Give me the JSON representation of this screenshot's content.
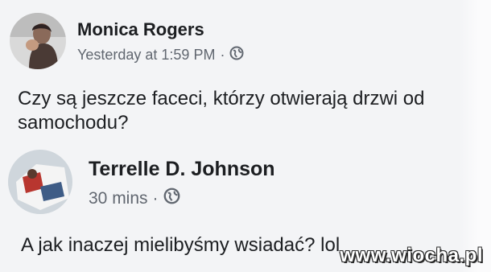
{
  "post": {
    "author": "Monica Rogers",
    "timestamp": "Yesterday at 1:59 PM",
    "separator": "·",
    "privacy_icon": "globe-icon",
    "text": "Czy są jeszcze faceci, którzy otwierają drzwi od samochodu?"
  },
  "comment": {
    "author": "Terrelle D. Johnson",
    "timestamp": "30 mins",
    "separator": "·",
    "privacy_icon": "globe-icon",
    "text": "A jak inaczej mielibyśmy wsiadać? lol"
  },
  "watermark": "www.wiocha.pl",
  "colors": {
    "background": "#f3f4f6",
    "name": "#1c1e21",
    "meta": "#616770"
  }
}
